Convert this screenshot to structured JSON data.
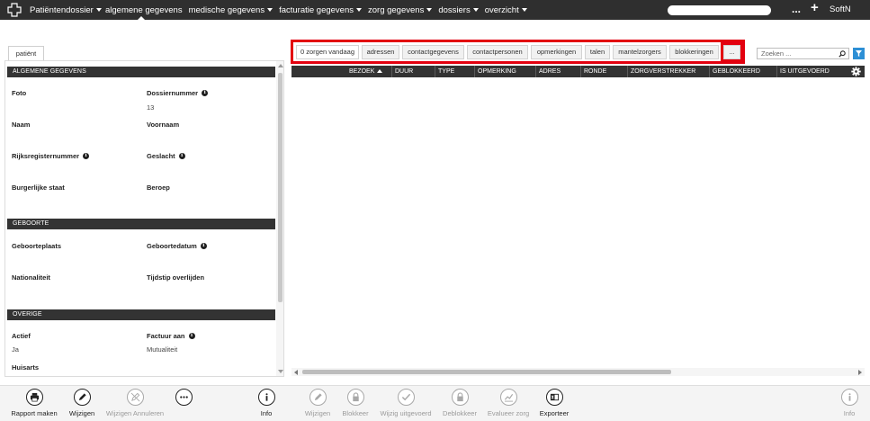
{
  "topbar": {
    "brand": "Patiëntendossier",
    "nav": [
      {
        "label": "algemene gegevens",
        "dropdown": false
      },
      {
        "label": "medische gegevens",
        "dropdown": true
      },
      {
        "label": "facturatie gegevens",
        "dropdown": true
      },
      {
        "label": "zorg gegevens",
        "dropdown": true
      },
      {
        "label": "dossiers",
        "dropdown": true
      },
      {
        "label": "overzicht",
        "dropdown": true
      }
    ],
    "more": "...",
    "add": "+",
    "user": "SoftN"
  },
  "left": {
    "tab": "patiënt",
    "sections": {
      "algemeen": "ALGEMENE GEGEVENS",
      "geboorte": "GEBOORTE",
      "overige": "OVERIGE"
    },
    "fields": {
      "foto": "Foto",
      "dossiernummer": "Dossiernummer",
      "dossiernummer_value": "13",
      "naam": "Naam",
      "voornaam": "Voornaam",
      "rijksregisternummer": "Rijksregisternummer",
      "geslacht": "Geslacht",
      "burgerlijke_staat": "Burgerlijke staat",
      "beroep": "Beroep",
      "geboorteplaats": "Geboorteplaats",
      "geboortedatum": "Geboortedatum",
      "nationaliteit": "Nationaliteit",
      "tijdstip_overlijden": "Tijdstip overlijden",
      "actief": "Actief",
      "actief_value": "Ja",
      "factuur_aan": "Factuur aan",
      "factuur_aan_value": "Mutualiteit",
      "huisarts": "Huisarts"
    }
  },
  "tabs": [
    "0 zorgen vandaag",
    "adressen",
    "contactgegevens",
    "contactpersonen",
    "opmerkingen",
    "talen",
    "mantelzorgers",
    "blokkeringen",
    "..."
  ],
  "search": {
    "placeholder": "Zoeken ..."
  },
  "grid": {
    "columns": [
      "BEZOEK",
      "DUUR",
      "TYPE",
      "OPMERKING",
      "ADRES",
      "RONDE",
      "ZORGVERSTREKKER",
      "GEBLOKKEERD",
      "IS UITGEVOERD"
    ],
    "sort_column": "BEZOEK"
  },
  "toolbar": [
    {
      "label": "Rapport maken",
      "icon": "print-icon",
      "enabled": true
    },
    {
      "label": "Wijzigen",
      "icon": "pencil-icon",
      "enabled": true
    },
    {
      "label": "Wijzigen Annuleren",
      "icon": "cancel-edit-icon",
      "enabled": false
    },
    {
      "label": "",
      "icon": "more-icon",
      "enabled": true
    },
    {
      "label": "Info",
      "icon": "info-icon",
      "enabled": true
    },
    {
      "label": "Wijzigen",
      "icon": "pencil-icon",
      "enabled": false
    },
    {
      "label": "Blokkeer",
      "icon": "lock-icon",
      "enabled": false
    },
    {
      "label": "Wijzig uitgevoerd",
      "icon": "check-icon",
      "enabled": false
    },
    {
      "label": "Deblokkeer",
      "icon": "unlock-icon",
      "enabled": false
    },
    {
      "label": "Evalueer zorg",
      "icon": "chart-icon",
      "enabled": false
    },
    {
      "label": "Exporteer",
      "icon": "excel-icon",
      "enabled": true
    },
    {
      "label": "Info",
      "icon": "info-icon",
      "enabled": false
    }
  ],
  "colors": {
    "topbar": "#2f2f2f",
    "highlight": "#e3000f",
    "filter": "#2d8fd5"
  }
}
